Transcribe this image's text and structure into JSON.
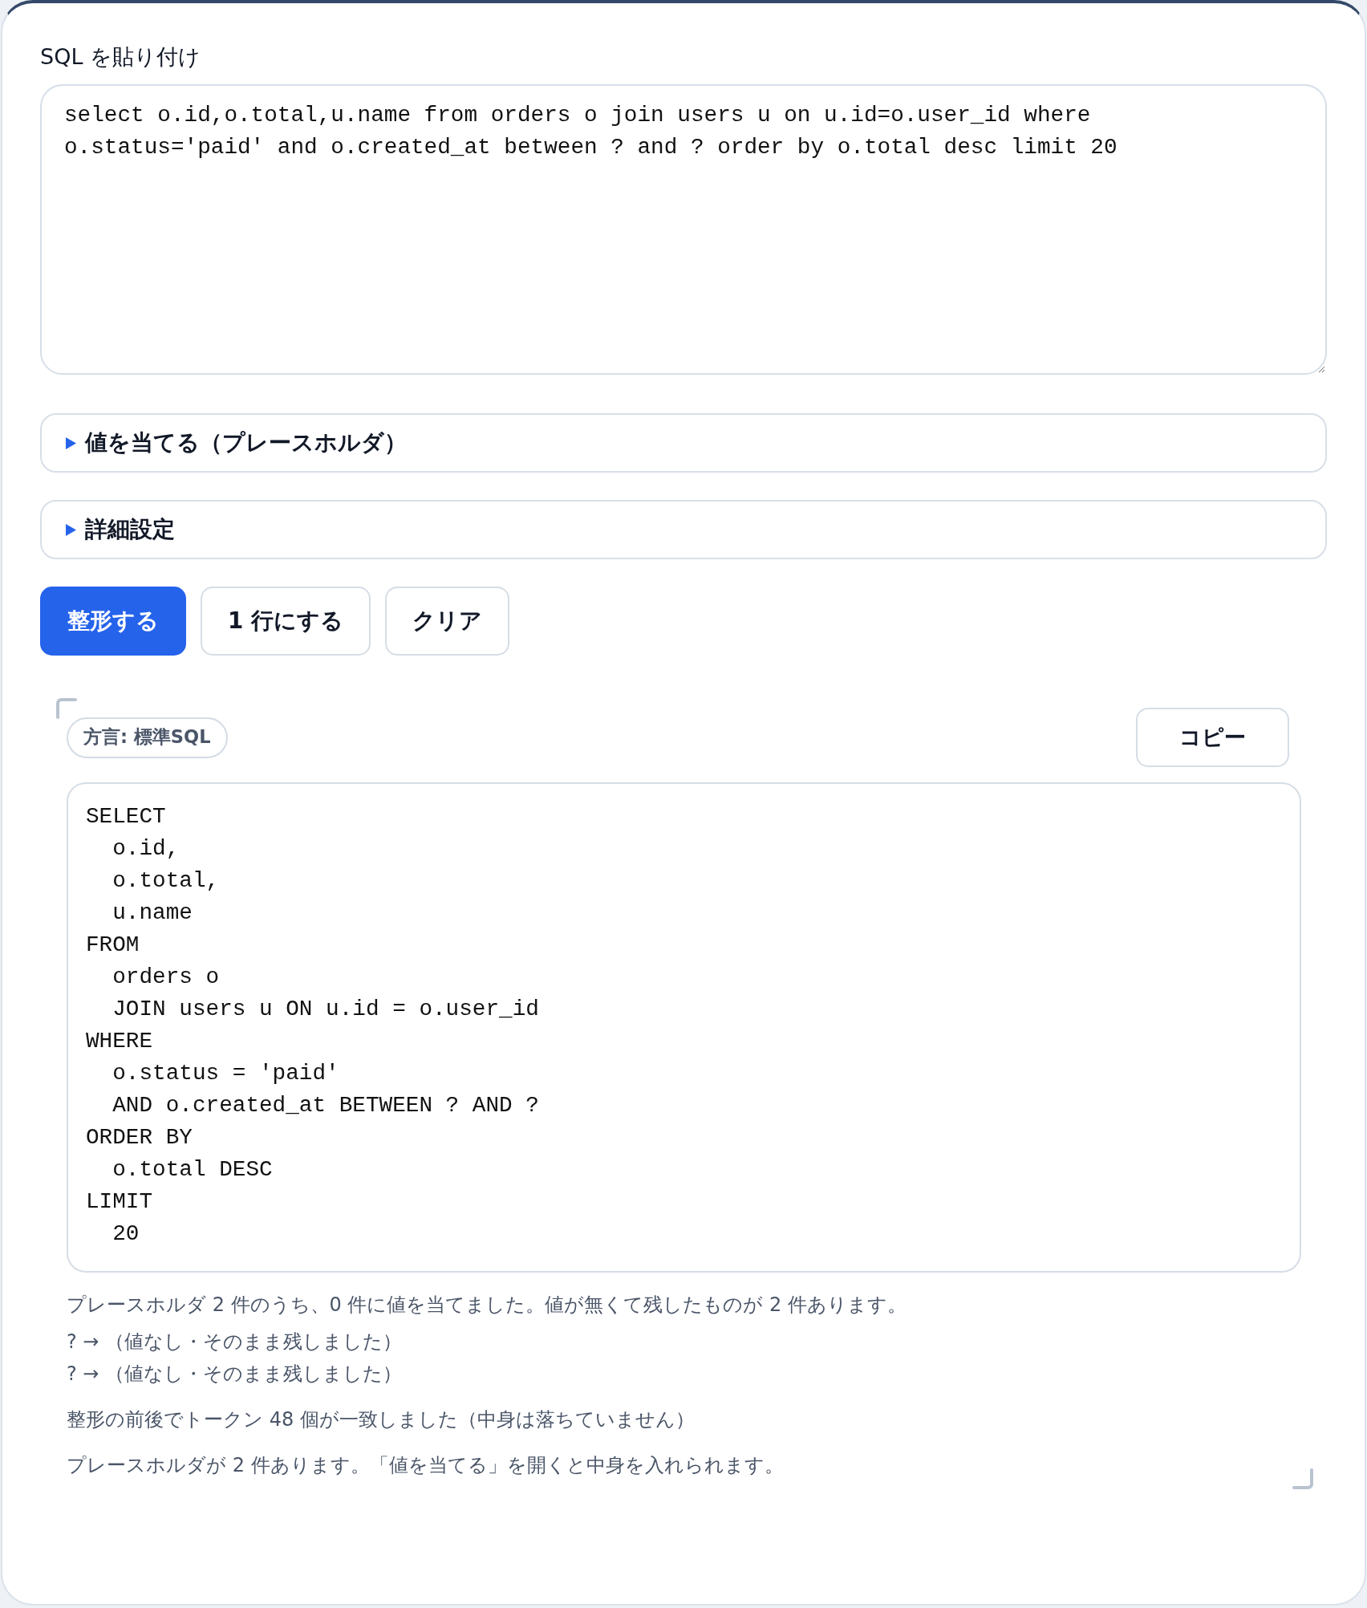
{
  "input": {
    "label": "SQL を貼り付け",
    "value": "select o.id,o.total,u.name from orders o join users u on u.id=o.user_id where o.status='paid' and o.created_at between ? and ? order by o.total desc limit 20"
  },
  "sections": [
    {
      "title": "値を当てる（プレースホルダ）",
      "expanded": false
    },
    {
      "title": "詳細設定",
      "expanded": false
    }
  ],
  "buttons": [
    {
      "label": "整形する",
      "kind": "primary"
    },
    {
      "label": "1 行にする",
      "kind": "secondary"
    },
    {
      "label": "クリア",
      "kind": "secondary"
    }
  ],
  "result": {
    "dialect_badge": "方言: 標準SQL",
    "copy_button": "コピー",
    "formatted_sql": [
      "SELECT",
      "  o.id,",
      "  o.total,",
      "  u.name",
      "FROM",
      "  orders o",
      "  JOIN users u ON u.id = o.user_id",
      "WHERE",
      "  o.status = 'paid'",
      "  AND o.created_at BETWEEN ? AND ?",
      "ORDER BY",
      "  o.total DESC",
      "LIMIT",
      "  20"
    ],
    "summary": "プレースホルダ 2 件のうち、0 件に値を当てました。値が無くて残したものが 2 件あります。",
    "placeholder_results": [
      "? → （値なし・そのまま残しました）",
      "? → （値なし・そのまま残しました）"
    ],
    "token_check": "整形の前後でトークン 48 個が一致しました（中身は落ちていません）",
    "hint": "プレースホルダが 2 件あります。「値を当てる」を開くと中身を入れられます。"
  }
}
